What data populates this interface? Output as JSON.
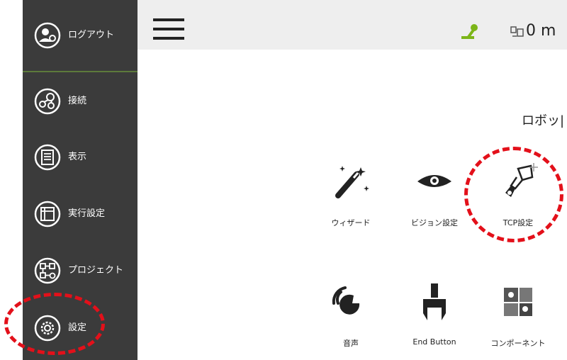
{
  "sidebar": {
    "items": [
      {
        "label": "ログアウト",
        "icon": "user-logout-icon"
      },
      {
        "label": "接続",
        "icon": "connection-icon"
      },
      {
        "label": "表示",
        "icon": "list-view-icon"
      },
      {
        "label": "実行設定",
        "icon": "run-settings-icon"
      },
      {
        "label": "プロジェクト",
        "icon": "project-flow-icon"
      },
      {
        "label": "設定",
        "icon": "gear-icon"
      }
    ]
  },
  "topbar": {
    "menu_icon": "hamburger-menu-icon",
    "status_icon": "robot-arm-status-icon",
    "distance_icon": "distance-icon",
    "distance_text": "0 m"
  },
  "main": {
    "title": "ロボッ|",
    "tiles": [
      {
        "label": "ウィザード",
        "icon": "magic-wand-icon"
      },
      {
        "label": "ビジョン設定",
        "icon": "eye-icon"
      },
      {
        "label": "TCP設定",
        "icon": "tcp-tool-icon"
      },
      {
        "label": "音声",
        "icon": "voice-icon"
      },
      {
        "label": "End Button",
        "icon": "end-button-icon"
      },
      {
        "label": "コンポーネント",
        "icon": "component-icon"
      }
    ]
  },
  "colors": {
    "sidebar_bg": "#3b3b3b",
    "topbar_bg": "#eeeeee",
    "accent_green": "#7cb518",
    "callout_red": "#e3101a"
  }
}
